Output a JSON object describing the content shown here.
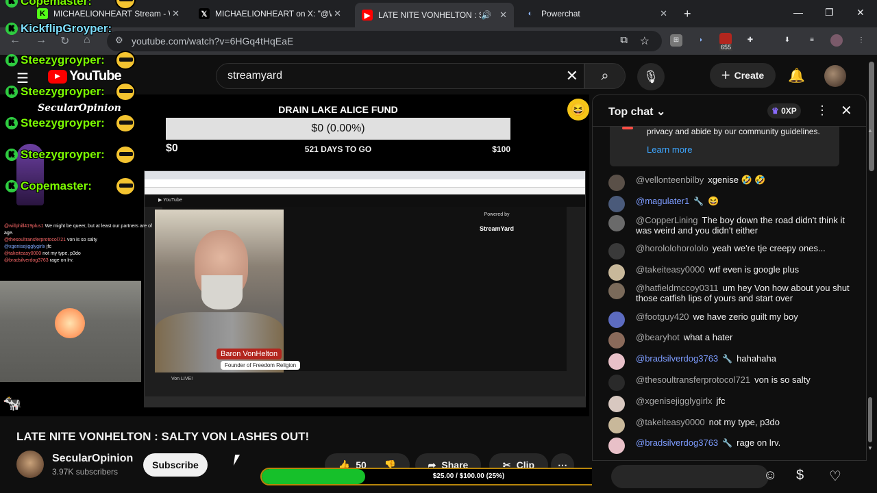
{
  "browser": {
    "tabs": [
      {
        "title": "MICHAELIONHEART Stream - W",
        "icon": "k-icon"
      },
      {
        "title": "MICHAELIONHEART on X: \"@W",
        "icon": "x-logo-icon"
      },
      {
        "title": "LATE NITE VONHELTON : SA",
        "icon": "youtube-icon"
      },
      {
        "title": "Powerchat",
        "icon": "powerchat-icon"
      }
    ],
    "url": "youtube.com/watch?v=6HGq4tHqEaE",
    "ext_badge": "655"
  },
  "youtube": {
    "logo_text": "YouTube",
    "search_query": "streamyard",
    "create_label": "Create"
  },
  "stream": {
    "fund_title": "DRAIN LAKE ALICE FUND",
    "fund_amount": "$0 (0.00%)",
    "fund_min": "$0",
    "fund_days": "521 DAYS TO GO",
    "fund_max": "$100",
    "powered_by": "Powered by",
    "streamyard": "StreamYard",
    "name_badge": "Baron VonHelton",
    "name_sub": "Founder of Freedom Religion",
    "cap_bottom": "Von LIVE!"
  },
  "overlay": {
    "names": [
      "Copemaster:",
      "KickflipGroyper:",
      "Steezygroyper:",
      "Steezygroyper:",
      "Steezygroyper:",
      "Steezygroyper:",
      "Copemaster:"
    ],
    "secular": "SecularOpinion",
    "chat": [
      {
        "user": "@willphill419plus1",
        "text": "We might be queer, but at least our partners are of age."
      },
      {
        "user": "@thesoultransferprotocol721",
        "text": "von is so salty"
      },
      {
        "user": "@xgenisejigglygirlx",
        "text": "jfc"
      },
      {
        "user": "@takeiteasy0000",
        "text": "not my type, p3do"
      },
      {
        "user": "@bradsilverdog3763",
        "text": "rage on lrv."
      }
    ]
  },
  "video": {
    "title": "LATE NITE VONHELTON : SALTY VON LASHES OUT!",
    "channel": "SecularOpinion",
    "subscribers": "3.97K subscribers",
    "subscribe_label": "Subscribe",
    "likes": "50",
    "share_label": "Share",
    "clip_label": "Clip"
  },
  "donation": {
    "label": "$25.00 / $100.00 (25%)",
    "progress": 0.25,
    "fill_color": "#16c02a"
  },
  "chat": {
    "mode": "Top chat",
    "xp": "0XP",
    "notice_text": "privacy and abide by our community guidelines.",
    "learn_more": "Learn more",
    "messages": [
      {
        "author": "@vellonteenbilby",
        "text": "xgenise 🤣 🤣",
        "mod": false,
        "av": "#5a5048"
      },
      {
        "author": "@magulater1",
        "text": "😆",
        "mod": true,
        "av": "#4a5a7a"
      },
      {
        "author": "@CopperLining",
        "text": "The boy down the road didn't think it was weird and you didn't either",
        "mod": false,
        "av": "#6a6a6a"
      },
      {
        "author": "@horololohorololo",
        "text": "yeah we're tje creepy ones...",
        "mod": false,
        "av": "#3a3a3a"
      },
      {
        "author": "@takeiteasy0000",
        "text": "wtf even is google plus",
        "mod": false,
        "av": "#c8b89a"
      },
      {
        "author": "@hatfieldmccoy0311",
        "text": "um hey Von how about you shut those catfish lips of yours and start over",
        "mod": false,
        "av": "#7a6a5a"
      },
      {
        "author": "@footguy420",
        "text": "we have zerio guilt my boy",
        "mod": false,
        "av": "#5c6bc0"
      },
      {
        "author": "@bearyhot",
        "text": "what a hater",
        "mod": false,
        "av": "#8a6a5a"
      },
      {
        "author": "@bradsilverdog3763",
        "text": "hahahaha",
        "mod": true,
        "av": "#e8c0c8"
      },
      {
        "author": "@thesoultransferprotocol721",
        "text": "von is so salty",
        "mod": false,
        "av": "#2a2a2a"
      },
      {
        "author": "@xgenisejigglygirlx",
        "text": "jfc",
        "mod": false,
        "av": "#d8c8c0"
      },
      {
        "author": "@takeiteasy0000",
        "text": "not my type, p3do",
        "mod": false,
        "av": "#c8b89a"
      },
      {
        "author": "@bradsilverdog3763",
        "text": "rage on lrv.",
        "mod": true,
        "av": "#e8c0c8"
      }
    ]
  }
}
